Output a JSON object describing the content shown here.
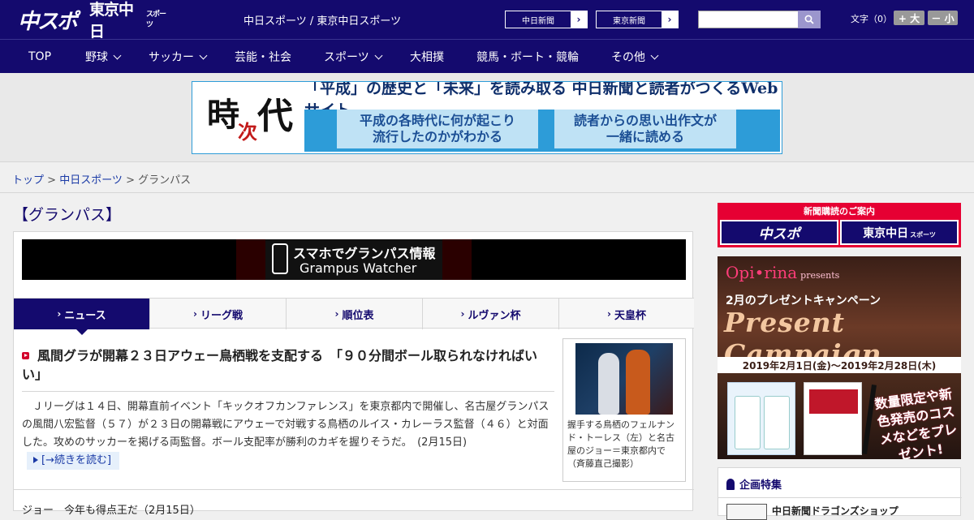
{
  "header": {
    "logo_chuspo": "中スポ",
    "logo_tokyo": "東京中日",
    "logo_tokyo_sub": "スポーツ",
    "site_title": "中日スポーツ / 東京中日スポーツ",
    "btn_chunichi": "中日新聞",
    "btn_tokyo": "東京新聞",
    "search_placeholder": "",
    "font_label": "文字（0）",
    "font_big": "+ 大",
    "font_small": "－ 小"
  },
  "nav": {
    "items": [
      {
        "label": "TOP"
      },
      {
        "label": "野球"
      },
      {
        "label": "サッカー"
      },
      {
        "label": "芸能・社会"
      },
      {
        "label": "スポーツ"
      },
      {
        "label": "大相撲"
      },
      {
        "label": "競馬・ボート・競輪"
      },
      {
        "label": "その他"
      }
    ]
  },
  "banner": {
    "ji": "時",
    "tsugi": "次",
    "dai": "代",
    "headline": "「平成」の歴史と「未来」を読み取る 中日新聞と読者がつくるWebサイト",
    "box1_line1": "平成の各時代に何が起こり",
    "box1_line2": "流行したのかがわかる",
    "box2_line1": "読者からの思い出作文が",
    "box2_line2": "一緒に読める"
  },
  "breadcrumb": {
    "top": "トップ",
    "sep": " > ",
    "chunichi": "中日スポーツ",
    "current": "グランパス"
  },
  "main": {
    "section_title": "【グランパス】",
    "promo_line1": "スマホでグランパス情報",
    "promo_line2": "Grampus Watcher",
    "tabs": [
      {
        "label": "ニュース"
      },
      {
        "label": "リーグ戦"
      },
      {
        "label": "順位表"
      },
      {
        "label": "ルヴァン杯"
      },
      {
        "label": "天皇杯"
      }
    ],
    "article": {
      "title": "風間グラが開幕２３日アウェー鳥栖戦を支配する　「９０分間ボール取られなければいい」",
      "body": "　Ｊリーグは１４日、開幕直前イベント「キックオフカンファレンス」を東京都内で開催し、名古屋グランパスの風間八宏監督（５７）が２３日の開幕戦にアウェーで対戦する鳥栖のルイス・カレーラス監督（４６）と対面した。攻めのサッカーを掲げる両監督。ボール支配率が勝利のカギを握りそうだ。　(2月15日)",
      "readmore": "[→続きを読む]",
      "photo_caption": "握手する鳥栖のフェルナンド・トーレス（左）と名古屋のジョー＝東京都内で（斉藤直己撮影）"
    },
    "next_title": "ジョー　今年も得点王だ（2月15日）"
  },
  "sidebar": {
    "subscribe_head": "新聞購読のご案内",
    "subscribe_chuspo": "中スポ",
    "subscribe_tokyo": "東京中日",
    "subscribe_tokyo_sub": "スポーツ",
    "ad_brand": "Opi•rina",
    "ad_brand_sub": "presents",
    "ad_campaign": "2月のプレゼントキャンペーン",
    "ad_present": "Present Campaign",
    "ad_dates": "2019年2月1日(金)～2019年2月28日(木)",
    "ad_limited": "数量限定や新色発売のコスメなどをプレゼント!",
    "feature_title": "企画特集",
    "feature_item": "中日新聞ドラゴンズショップ"
  }
}
